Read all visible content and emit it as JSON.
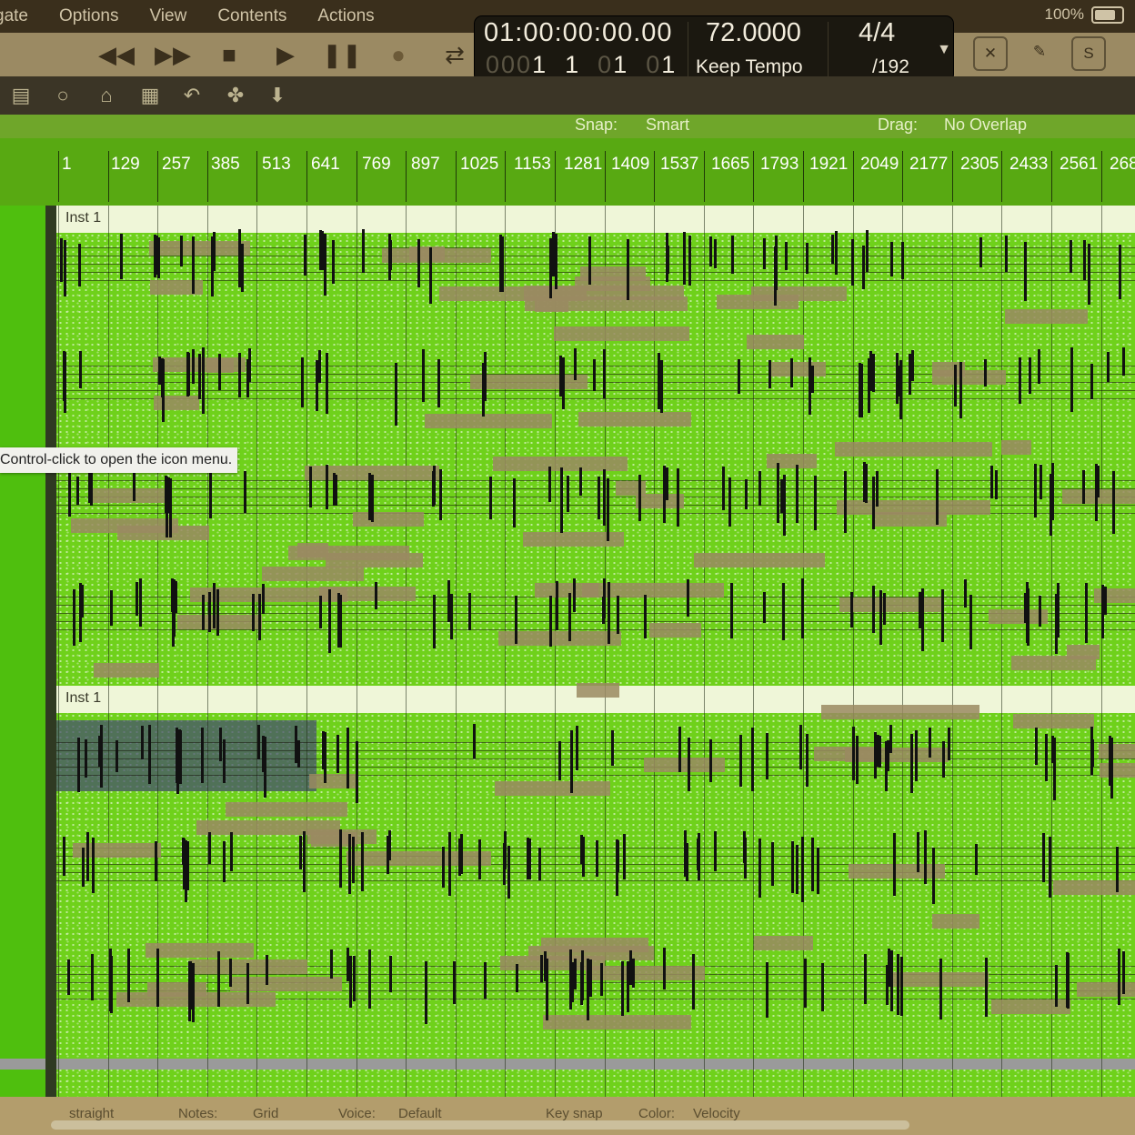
{
  "menu": {
    "items": [
      "gate",
      "Options",
      "View",
      "Contents",
      "Actions"
    ],
    "battery": "100%"
  },
  "transport": {
    "rewind": "◀◀",
    "forward": "▶▶",
    "stop": "■",
    "play": "▶",
    "pause": "❚❚",
    "record": "●",
    "cycle": "⇄"
  },
  "lcd": {
    "time": "01:00:00:00.00",
    "bars_dim": "000",
    "bars": "1  1  01  01",
    "bars_parts": [
      "000",
      "1",
      "1",
      "0",
      "1",
      "0",
      "1"
    ],
    "tempo": "72.0000",
    "tempo_mode": "Keep Tempo",
    "signature": "4/4",
    "division": "/192"
  },
  "local_header": {
    "snap_label": "Snap:",
    "snap_value": "Smart",
    "drag_label": "Drag:",
    "drag_value": "No Overlap"
  },
  "ruler": {
    "labels": [
      "1",
      "129",
      "257",
      "385",
      "513",
      "641",
      "769",
      "897",
      "1025",
      "1153",
      "1281",
      "1409",
      "1537",
      "1665",
      "1793",
      "1921",
      "2049",
      "2177",
      "2305",
      "2433",
      "2561",
      "268"
    ]
  },
  "score": {
    "instrument_1": "Inst 1",
    "instrument_2": "Inst 1"
  },
  "tooltip": "Control-click to open the icon menu.",
  "bottom": {
    "straight": "straight",
    "notes": "Notes:",
    "grid": "Grid",
    "voice": "Voice:",
    "default": "Default",
    "key_snap": "Key snap",
    "color_label": "Color:",
    "color_value": "Velocity"
  },
  "colors": {
    "score_green": "#6fd11b",
    "ruler_green": "#58a912",
    "banner": "#eff6d8",
    "lcd_bg": "#1b1810"
  }
}
